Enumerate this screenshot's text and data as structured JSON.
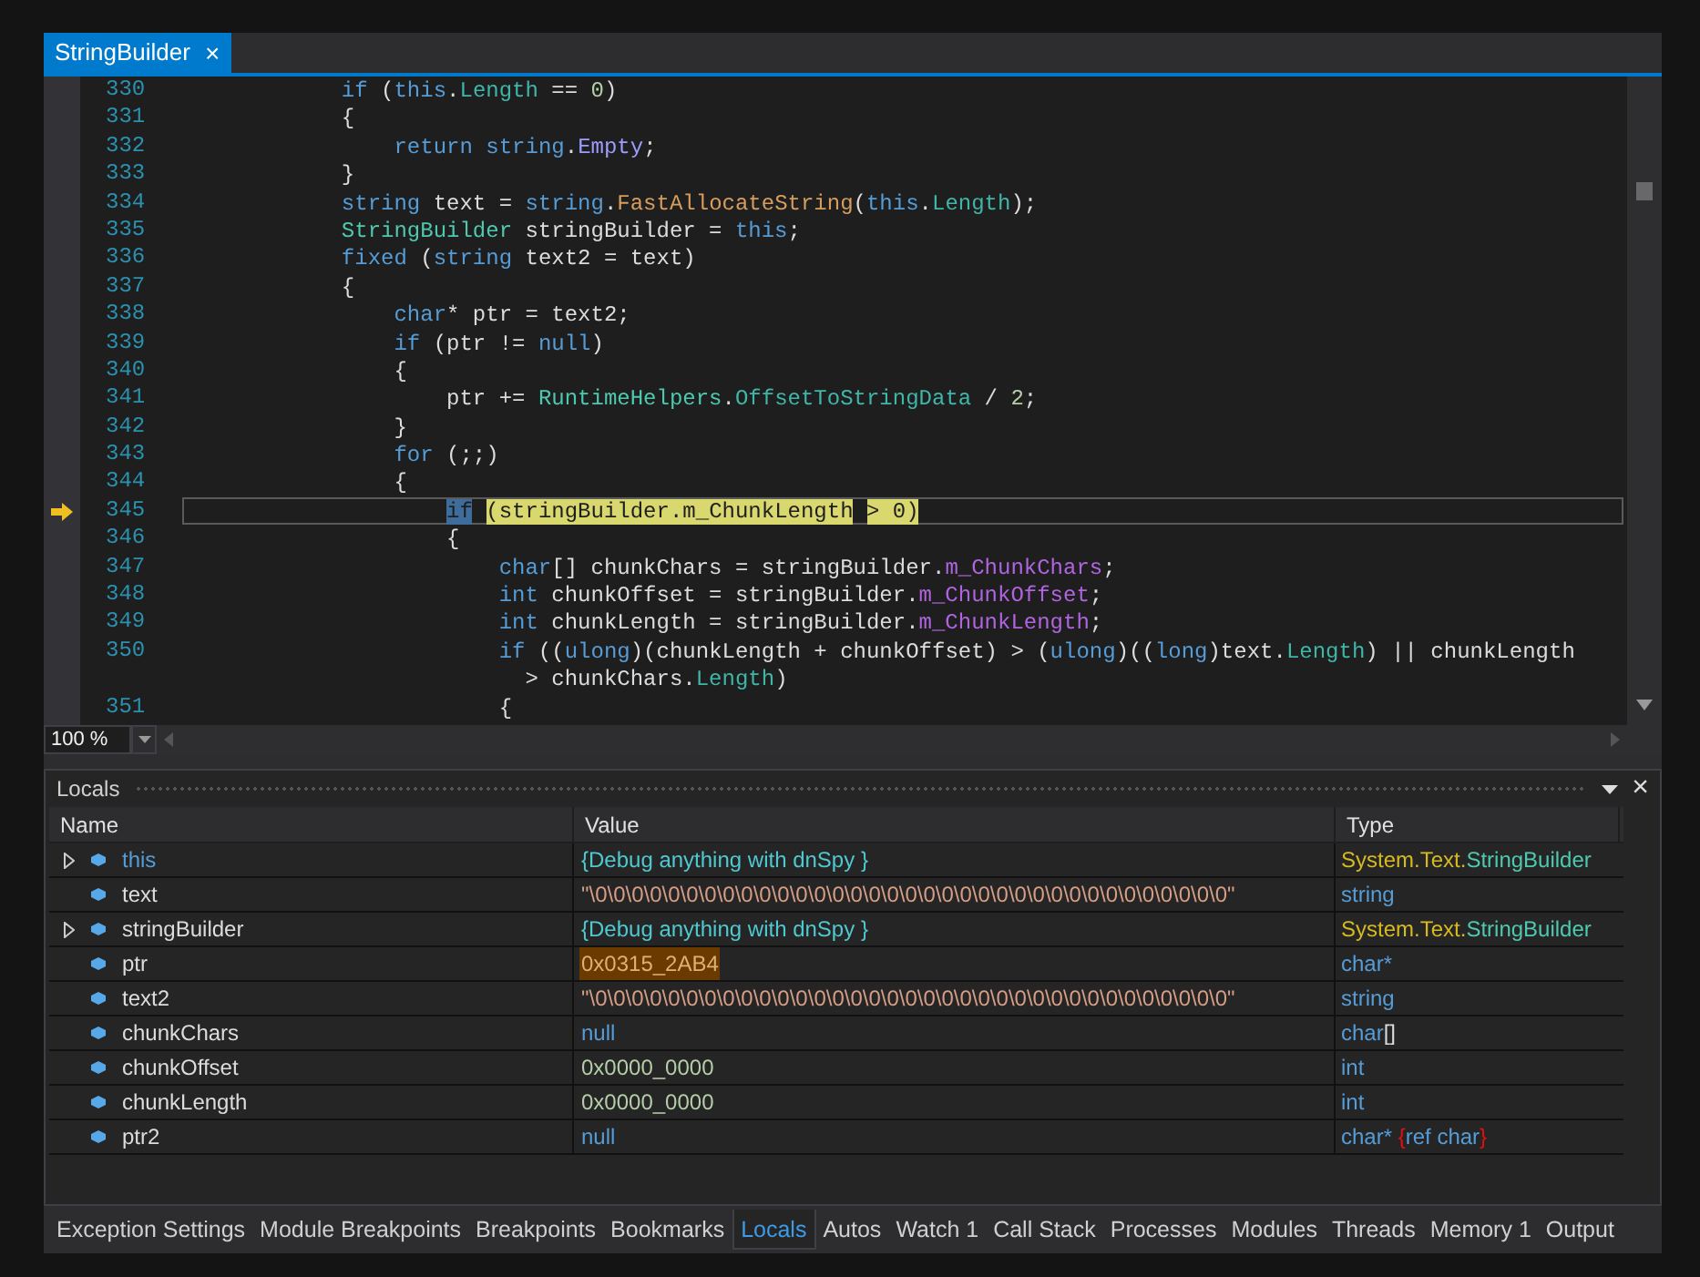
{
  "editor": {
    "tab": {
      "title": "StringBuilder",
      "close": "×",
      "selected": true
    },
    "lines": [
      {
        "number": "330",
        "current": false,
        "tokens": [
          {
            "text": "            if",
            "kind": "keyword"
          },
          {
            "text": " (",
            "kind": "plain"
          },
          {
            "text": "this",
            "kind": "keyword"
          },
          {
            "text": ".",
            "kind": "plain"
          },
          {
            "text": "Length",
            "kind": "property"
          },
          {
            "text": " == ",
            "kind": "plain"
          },
          {
            "text": "0",
            "kind": "number"
          },
          {
            "text": ")",
            "kind": "plain"
          }
        ]
      },
      {
        "number": "331",
        "current": false,
        "tokens": [
          {
            "text": "            {",
            "kind": "plain"
          }
        ]
      },
      {
        "number": "332",
        "current": false,
        "tokens": [
          {
            "text": "                return",
            "kind": "keyword"
          },
          {
            "text": " string",
            "kind": "keyword"
          },
          {
            "text": ".",
            "kind": "plain"
          },
          {
            "text": "Empty",
            "kind": "static_field"
          },
          {
            "text": ";",
            "kind": "plain"
          }
        ]
      },
      {
        "number": "333",
        "current": false,
        "tokens": [
          {
            "text": "            }",
            "kind": "plain"
          }
        ]
      },
      {
        "number": "334",
        "current": false,
        "tokens": [
          {
            "text": "            string",
            "kind": "keyword"
          },
          {
            "text": " text = ",
            "kind": "plain"
          },
          {
            "text": "string",
            "kind": "keyword"
          },
          {
            "text": ".",
            "kind": "plain"
          },
          {
            "text": "FastAllocateString",
            "kind": "method"
          },
          {
            "text": "(",
            "kind": "plain"
          },
          {
            "text": "this",
            "kind": "keyword"
          },
          {
            "text": ".",
            "kind": "plain"
          },
          {
            "text": "Length",
            "kind": "property"
          },
          {
            "text": ");",
            "kind": "plain"
          }
        ]
      },
      {
        "number": "335",
        "current": false,
        "tokens": [
          {
            "text": "            StringBuilder",
            "kind": "type"
          },
          {
            "text": " stringBuilder = ",
            "kind": "plain"
          },
          {
            "text": "this",
            "kind": "keyword"
          },
          {
            "text": ";",
            "kind": "plain"
          }
        ]
      },
      {
        "number": "336",
        "current": false,
        "tokens": [
          {
            "text": "            fixed",
            "kind": "keyword"
          },
          {
            "text": " (",
            "kind": "plain"
          },
          {
            "text": "string",
            "kind": "keyword"
          },
          {
            "text": " text2 = text)",
            "kind": "plain"
          }
        ]
      },
      {
        "number": "337",
        "current": false,
        "tokens": [
          {
            "text": "            {",
            "kind": "plain"
          }
        ]
      },
      {
        "number": "338",
        "current": false,
        "tokens": [
          {
            "text": "                char",
            "kind": "keyword"
          },
          {
            "text": "* ptr = text2;",
            "kind": "plain"
          }
        ]
      },
      {
        "number": "339",
        "current": false,
        "tokens": [
          {
            "text": "                if",
            "kind": "keyword"
          },
          {
            "text": " (ptr != ",
            "kind": "plain"
          },
          {
            "text": "null",
            "kind": "keyword"
          },
          {
            "text": ")",
            "kind": "plain"
          }
        ]
      },
      {
        "number": "340",
        "current": false,
        "tokens": [
          {
            "text": "                {",
            "kind": "plain"
          }
        ]
      },
      {
        "number": "341",
        "current": false,
        "tokens": [
          {
            "text": "                    ptr += ",
            "kind": "plain"
          },
          {
            "text": "RuntimeHelpers",
            "kind": "type"
          },
          {
            "text": ".",
            "kind": "plain"
          },
          {
            "text": "OffsetToStringData",
            "kind": "property"
          },
          {
            "text": " / ",
            "kind": "plain"
          },
          {
            "text": "2",
            "kind": "number"
          },
          {
            "text": ";",
            "kind": "plain"
          }
        ]
      },
      {
        "number": "342",
        "current": false,
        "tokens": [
          {
            "text": "                }",
            "kind": "plain"
          }
        ]
      },
      {
        "number": "343",
        "current": false,
        "tokens": [
          {
            "text": "                for",
            "kind": "keyword"
          },
          {
            "text": " (;;)",
            "kind": "plain"
          }
        ]
      },
      {
        "number": "344",
        "current": false,
        "tokens": [
          {
            "text": "                {",
            "kind": "plain"
          }
        ]
      },
      {
        "number": "345",
        "current": true,
        "tokens": [
          {
            "text": "                    if",
            "kind": "keyword"
          },
          {
            "text": " (stringBuilder.",
            "kind": "plain"
          },
          {
            "text": "m_ChunkLength",
            "kind": "field"
          },
          {
            "text": " > ",
            "kind": "plain"
          },
          {
            "text": "0",
            "kind": "number"
          },
          {
            "text": ")",
            "kind": "plain"
          }
        ]
      },
      {
        "number": "346",
        "current": false,
        "tokens": [
          {
            "text": "                    {",
            "kind": "plain"
          }
        ]
      },
      {
        "number": "347",
        "current": false,
        "tokens": [
          {
            "text": "                        char",
            "kind": "keyword"
          },
          {
            "text": "[] chunkChars = stringBuilder.",
            "kind": "plain"
          },
          {
            "text": "m_ChunkChars",
            "kind": "field"
          },
          {
            "text": ";",
            "kind": "plain"
          }
        ]
      },
      {
        "number": "348",
        "current": false,
        "tokens": [
          {
            "text": "                        int",
            "kind": "keyword"
          },
          {
            "text": " chunkOffset = stringBuilder.",
            "kind": "plain"
          },
          {
            "text": "m_ChunkOffset",
            "kind": "field"
          },
          {
            "text": ";",
            "kind": "plain"
          }
        ]
      },
      {
        "number": "349",
        "current": false,
        "tokens": [
          {
            "text": "                        int",
            "kind": "keyword"
          },
          {
            "text": " chunkLength = stringBuilder.",
            "kind": "plain"
          },
          {
            "text": "m_ChunkLength",
            "kind": "field"
          },
          {
            "text": ";",
            "kind": "plain"
          }
        ]
      },
      {
        "number": "350",
        "current": false,
        "tokens": [
          {
            "text": "                        if",
            "kind": "keyword"
          },
          {
            "text": " ((",
            "kind": "plain"
          },
          {
            "text": "ulong",
            "kind": "keyword"
          },
          {
            "text": ")(chunkLength + chunkOffset) > (",
            "kind": "plain"
          },
          {
            "text": "ulong",
            "kind": "keyword"
          },
          {
            "text": ")((",
            "kind": "plain"
          },
          {
            "text": "long",
            "kind": "keyword"
          },
          {
            "text": ")text.",
            "kind": "plain"
          },
          {
            "text": "Length",
            "kind": "property"
          },
          {
            "text": ") || chunkLength",
            "kind": "plain"
          }
        ],
        "continuation": [
          {
            "text": "                          > chunkChars.",
            "kind": "plain"
          },
          {
            "text": "Length",
            "kind": "property"
          },
          {
            "text": ")",
            "kind": "plain"
          }
        ]
      },
      {
        "number": "351",
        "current": false,
        "tokens": [
          {
            "text": "                        {",
            "kind": "plain"
          }
        ]
      }
    ],
    "zoom": "100 %"
  },
  "locals": {
    "title": "Locals",
    "close": "×",
    "columns": [
      "Name",
      "Value",
      "Type"
    ],
    "rows": [
      {
        "name": {
          "text": "this",
          "kind": "keyword"
        },
        "expandable": true,
        "value": {
          "text": "{Debug anything with dnSpy }",
          "kind": "object"
        },
        "changed": false,
        "type": [
          {
            "text": "System.Text.",
            "kind": "namespace"
          },
          {
            "text": "StringBuilder",
            "kind": "type"
          }
        ]
      },
      {
        "name": {
          "text": "text",
          "kind": "plain"
        },
        "expandable": false,
        "value": {
          "text": "\"\\0\\0\\0\\0\\0\\0\\0\\0\\0\\0\\0\\0\\0\\0\\0\\0\\0\\0\\0\\0\\0\\0\\0\\0\\0\\0\\0\\0\\0\\0\\0\\0\\0\\0\\0\"",
          "kind": "string"
        },
        "changed": false,
        "type": [
          {
            "text": "string",
            "kind": "keyword"
          }
        ]
      },
      {
        "name": {
          "text": "stringBuilder",
          "kind": "plain"
        },
        "expandable": true,
        "value": {
          "text": "{Debug anything with dnSpy }",
          "kind": "object"
        },
        "changed": false,
        "type": [
          {
            "text": "System.Text.",
            "kind": "namespace"
          },
          {
            "text": "StringBuilder",
            "kind": "type"
          }
        ]
      },
      {
        "name": {
          "text": "ptr",
          "kind": "plain"
        },
        "expandable": false,
        "value": {
          "text": "0x0315_2AB4",
          "kind": "number"
        },
        "changed": true,
        "type": [
          {
            "text": "char*",
            "kind": "keyword"
          }
        ]
      },
      {
        "name": {
          "text": "text2",
          "kind": "plain"
        },
        "expandable": false,
        "value": {
          "text": "\"\\0\\0\\0\\0\\0\\0\\0\\0\\0\\0\\0\\0\\0\\0\\0\\0\\0\\0\\0\\0\\0\\0\\0\\0\\0\\0\\0\\0\\0\\0\\0\\0\\0\\0\\0\"",
          "kind": "string"
        },
        "changed": false,
        "type": [
          {
            "text": "string",
            "kind": "keyword"
          }
        ]
      },
      {
        "name": {
          "text": "chunkChars",
          "kind": "plain"
        },
        "expandable": false,
        "value": {
          "text": "null",
          "kind": "keyword"
        },
        "changed": false,
        "type": [
          {
            "text": "char",
            "kind": "keyword"
          },
          {
            "text": "[]",
            "kind": "plain"
          }
        ]
      },
      {
        "name": {
          "text": "chunkOffset",
          "kind": "plain"
        },
        "expandable": false,
        "value": {
          "text": "0x0000_0000",
          "kind": "number"
        },
        "changed": false,
        "type": [
          {
            "text": "int",
            "kind": "keyword"
          }
        ]
      },
      {
        "name": {
          "text": "chunkLength",
          "kind": "plain"
        },
        "expandable": false,
        "value": {
          "text": "0x0000_0000",
          "kind": "number"
        },
        "changed": false,
        "type": [
          {
            "text": "int",
            "kind": "keyword"
          }
        ]
      },
      {
        "name": {
          "text": "ptr2",
          "kind": "plain"
        },
        "expandable": false,
        "value": {
          "text": "null",
          "kind": "keyword"
        },
        "changed": false,
        "type": [
          {
            "text": "char*",
            "kind": "keyword"
          },
          {
            "text": " {",
            "kind": "error"
          },
          {
            "text": "ref char",
            "kind": "keyword"
          },
          {
            "text": "}",
            "kind": "error"
          }
        ]
      }
    ]
  },
  "bottom_tabs": [
    {
      "label": "Exception Settings",
      "selected": false
    },
    {
      "label": "Module Breakpoints",
      "selected": false
    },
    {
      "label": "Breakpoints",
      "selected": false
    },
    {
      "label": "Bookmarks",
      "selected": false
    },
    {
      "label": "Locals",
      "selected": true
    },
    {
      "label": "Autos",
      "selected": false
    },
    {
      "label": "Watch 1",
      "selected": false
    },
    {
      "label": "Call Stack",
      "selected": false
    },
    {
      "label": "Processes",
      "selected": false
    },
    {
      "label": "Modules",
      "selected": false
    },
    {
      "label": "Threads",
      "selected": false
    },
    {
      "label": "Memory 1",
      "selected": false
    },
    {
      "label": "Output",
      "selected": false
    }
  ]
}
